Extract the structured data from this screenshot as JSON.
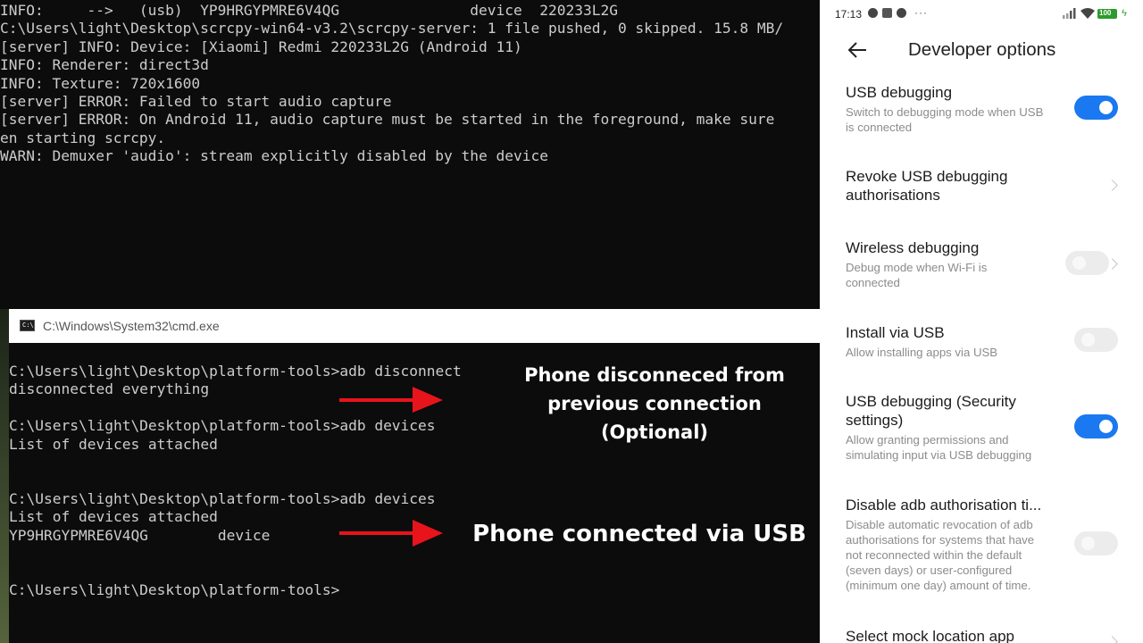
{
  "top_terminal": {
    "lines": [
      "INFO:     -->   (usb)  YP9HRGYPMRE6V4QG               device  220233L2G",
      "C:\\Users\\light\\Desktop\\scrcpy-win64-v3.2\\scrcpy-server: 1 file pushed, 0 skipped. 15.8 MB/",
      "[server] INFO: Device: [Xiaomi] Redmi 220233L2G (Android 11)",
      "INFO: Renderer: direct3d",
      "INFO: Texture: 720x1600",
      "[server] ERROR: Failed to start audio capture",
      "[server] ERROR: On Android 11, audio capture must be started in the foreground, make sure",
      "en starting scrcpy.",
      "WARN: Demuxer 'audio': stream explicitly disabled by the device"
    ]
  },
  "cmd_window": {
    "title": "C:\\Windows\\System32\\cmd.exe",
    "icon_text": "C:\\.",
    "lines": [
      "C:\\Users\\light\\Desktop\\platform-tools>adb disconnect",
      "disconnected everything",
      "",
      "C:\\Users\\light\\Desktop\\platform-tools>adb devices",
      "List of devices attached",
      "",
      "",
      "C:\\Users\\light\\Desktop\\platform-tools>adb devices",
      "List of devices attached",
      "YP9HRGYPMRE6V4QG        device",
      "",
      "C:\\Users\\light\\Desktop\\platform-tools>"
    ]
  },
  "annotations": {
    "first": [
      "Phone disconneced from",
      "previous connection",
      "(Optional)"
    ],
    "second": "Phone connected via USB",
    "arrow_color": "#e8141b"
  },
  "phone": {
    "status_bar": {
      "time": "17:13",
      "more": "···",
      "battery": "100"
    },
    "title": "Developer options",
    "accent": "#1a78f0",
    "settings": [
      {
        "title": "USB debugging",
        "subtitle": [
          "Switch to debugging mode when USB",
          "is connected"
        ],
        "control": "toggle",
        "on": true
      },
      {
        "title": [
          "Revoke USB debugging",
          "authorisations"
        ],
        "control": "chevron"
      },
      {
        "title": "Wireless debugging",
        "subtitle": [
          "Debug mode when Wi-Fi is",
          "connected"
        ],
        "control": "toggle+chevron",
        "on": false
      },
      {
        "title": "Install via USB",
        "subtitle": [
          "Allow installing apps via USB"
        ],
        "control": "toggle",
        "on": false
      },
      {
        "title": [
          "USB debugging (Security",
          "settings)"
        ],
        "subtitle": [
          "Allow granting permissions and",
          "simulating input via USB debugging"
        ],
        "control": "toggle",
        "on": true
      },
      {
        "title": "Disable adb authorisation ti...",
        "subtitle": [
          "Disable automatic revocation of adb",
          "authorisations for systems that have",
          "not reconnected within the default",
          "(seven days) or user-configured",
          "(minimum one day) amount of time."
        ],
        "control": "toggle",
        "on": false
      },
      {
        "title": "Select mock location app",
        "control": "chevron"
      }
    ]
  }
}
